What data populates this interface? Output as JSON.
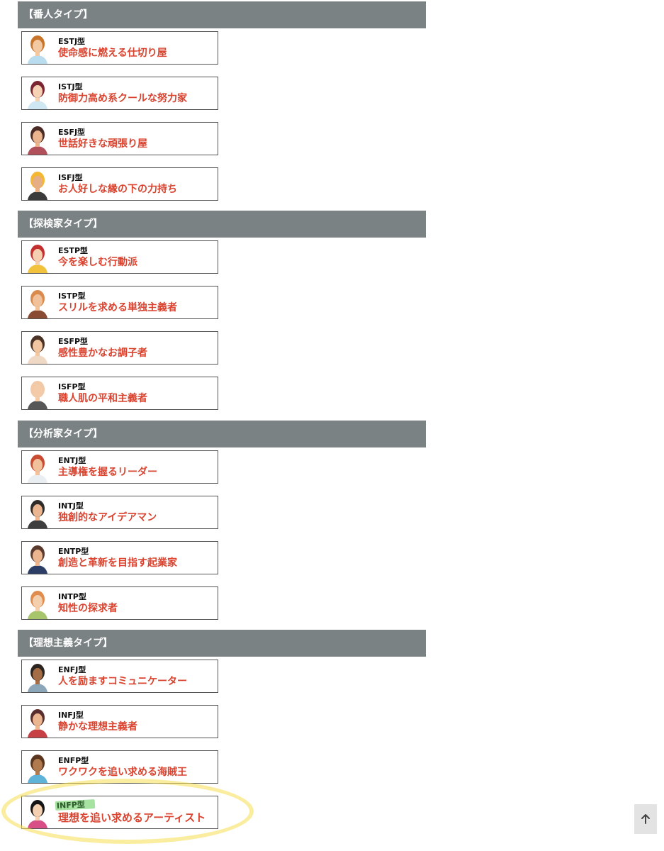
{
  "sections": [
    {
      "title": "【番人タイプ】",
      "items": [
        {
          "code": "ESTJ型",
          "title": "使命感に燃える仕切り屋",
          "avatar": {
            "icon": "woman-short-hair-icon",
            "hair": "#c8752c",
            "skin": "#f3c9a4",
            "shirt": "#b9dcef"
          }
        },
        {
          "code": "ISTJ型",
          "title": "防御力高め系クールな努力家",
          "avatar": {
            "icon": "woman-dark-hair-icon",
            "hair": "#7a2531",
            "skin": "#f5d2b3",
            "shirt": "#cfe7f3"
          }
        },
        {
          "code": "ESFJ型",
          "title": "世話好きな頑張り屋",
          "avatar": {
            "icon": "woman-long-hair-icon",
            "hair": "#4a2b25",
            "skin": "#e9b48e",
            "shirt": "#b14f5b"
          }
        },
        {
          "code": "ISFJ型",
          "title": "お人好しな縁の下の力持ち",
          "avatar": {
            "icon": "man-hard-hat-icon",
            "hair": "#f3b733",
            "skin": "#e6ae84",
            "shirt": "#3b3b3b"
          }
        }
      ]
    },
    {
      "title": "【探検家タイプ】",
      "items": [
        {
          "code": "ESTP型",
          "title": "今を楽しむ行動派",
          "avatar": {
            "icon": "woman-red-hair-icon",
            "hair": "#c2302f",
            "skin": "#f5d0b0",
            "shirt": "#f2c23d"
          }
        },
        {
          "code": "ISTP型",
          "title": "スリルを求める単独主義者",
          "avatar": {
            "icon": "man-beard-icon",
            "hair": "#d98b4e",
            "skin": "#f0c19b",
            "shirt": "#8a4b35"
          }
        },
        {
          "code": "ESFP型",
          "title": "感性豊かなお調子者",
          "avatar": {
            "icon": "woman-curly-hair-icon",
            "hair": "#4b3327",
            "skin": "#f1c6a0",
            "shirt": "#f0d9c4"
          }
        },
        {
          "code": "ISFP型",
          "title": "職人肌の平和主義者",
          "avatar": {
            "icon": "man-headband-icon",
            "hair": "#f1c9a6",
            "skin": "#f3cba8",
            "shirt": "#575757"
          }
        }
      ]
    },
    {
      "title": "【分析家タイプ】",
      "items": [
        {
          "code": "ENTJ型",
          "title": "主導権を握るリーダー",
          "avatar": {
            "icon": "man-red-beard-icon",
            "hair": "#c84b32",
            "skin": "#f0c19b",
            "shirt": "#e9eef2"
          }
        },
        {
          "code": "INTJ型",
          "title": "独創的なアイデアマン",
          "avatar": {
            "icon": "man-dark-beard-icon",
            "hair": "#2f2b29",
            "skin": "#eab58f",
            "shirt": "#3e3e3e"
          }
        },
        {
          "code": "ENTP型",
          "title": "創造と革新を目指す起業家",
          "avatar": {
            "icon": "man-suit-beard-icon",
            "hair": "#5a3a2e",
            "skin": "#eab58f",
            "shirt": "#2d3e66"
          }
        },
        {
          "code": "INTP型",
          "title": "知性の探求者",
          "avatar": {
            "icon": "woman-orange-hair-icon",
            "hair": "#e08c4e",
            "skin": "#f4cfae",
            "shirt": "#a7c56b"
          }
        }
      ]
    },
    {
      "title": "【理想主義タイプ】",
      "items": [
        {
          "code": "ENFJ型",
          "title": "人を励ますコミュニケーター",
          "avatar": {
            "icon": "man-dark-skin-icon",
            "hair": "#2c2420",
            "skin": "#a46d45",
            "shirt": "#8aa6b8"
          }
        },
        {
          "code": "INFJ型",
          "title": "静かな理想主義者",
          "avatar": {
            "icon": "man-mustache-icon",
            "hair": "#5b2e2e",
            "skin": "#eab58f",
            "shirt": "#c64044"
          }
        },
        {
          "code": "ENFP型",
          "title": "ワクワクを追い求める海賊王",
          "avatar": {
            "icon": "man-afro-icon",
            "hair": "#5a361f",
            "skin": "#b07a4e",
            "shirt": "#5fb3d9"
          }
        },
        {
          "code": "INFP型",
          "title": "理想を追い求めるアーティスト",
          "highlight": true,
          "avatar": {
            "icon": "woman-black-hair-icon",
            "hair": "#151515",
            "skin": "#f5d0b0",
            "shirt": "#d84f87"
          }
        }
      ]
    }
  ],
  "scroll_top": {
    "icon": "arrow-up-icon"
  }
}
